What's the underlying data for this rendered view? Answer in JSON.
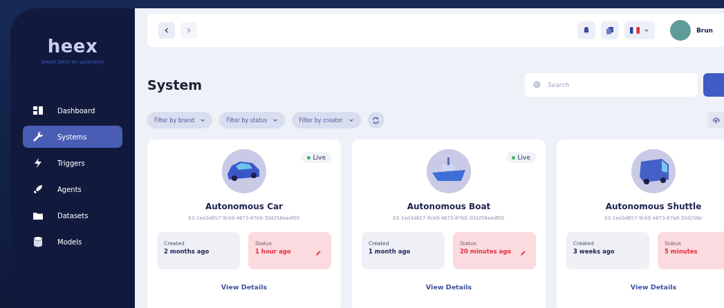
{
  "sidebar": {
    "logo": "heex",
    "tagline": "Smart DATA for autonomy",
    "items": [
      {
        "label": "Dashboard",
        "selected": false
      },
      {
        "label": "Systems",
        "selected": true
      },
      {
        "label": "Triggers",
        "selected": false
      },
      {
        "label": "Agents",
        "selected": false
      },
      {
        "label": "Datasets",
        "selected": false
      },
      {
        "label": "Models",
        "selected": false
      }
    ]
  },
  "topbar": {
    "back_disabled": false,
    "forward_disabled": true,
    "user_name": "Brun"
  },
  "page": {
    "title": "System",
    "search": {
      "placeholder": "Search"
    },
    "filters": [
      "Filter by brand",
      "Filter by status",
      "Filter by creator"
    ]
  },
  "cards": [
    {
      "kind": "car",
      "name": "Autonomous Car",
      "id": "ES-1ed3d657-9cb9-4873-87b0-30d256eedf05",
      "badge": "Live",
      "created_label": "Created",
      "created": "2 months ago",
      "status_label": "Status",
      "status": "1 hour ago",
      "link": "View Details"
    },
    {
      "kind": "boat",
      "name": "Autonomous Boat",
      "id": "ES-1ed3d657-9cb9-4873-87b0-30d256eedf05",
      "badge": "Live",
      "created_label": "Created",
      "created": "1 month ago",
      "status_label": "Status",
      "status": "20 minutes ago",
      "link": "View Details"
    },
    {
      "kind": "shuttle",
      "name": "Autonomous Shuttle",
      "id": "ES-1ed3d657-9cb9-4873-87b0-30d256e",
      "created_label": "Created",
      "created": "3 weeks ago",
      "status_label": "Status",
      "status": "5 minutes",
      "link": "View Details"
    }
  ]
}
